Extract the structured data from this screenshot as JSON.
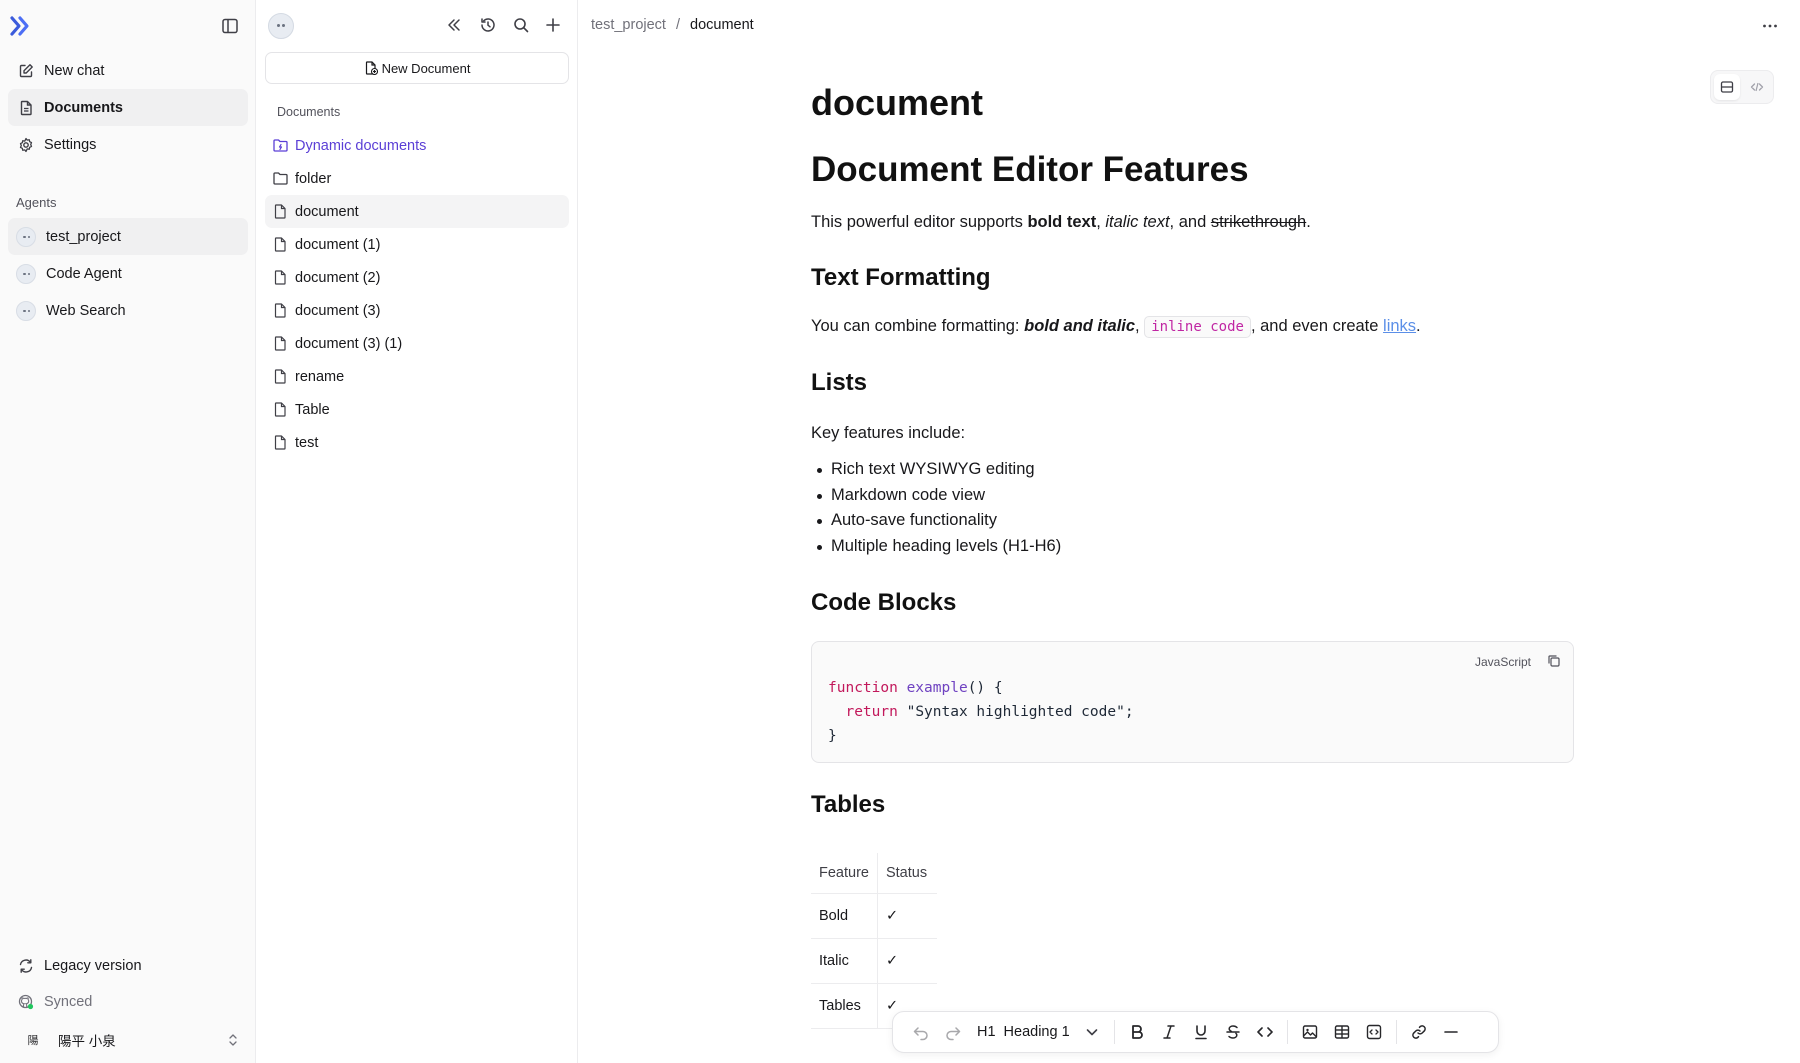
{
  "sidebar": {
    "nav": [
      {
        "label": "New chat",
        "icon": "edit-icon"
      },
      {
        "label": "Documents",
        "icon": "file-icon"
      },
      {
        "label": "Settings",
        "icon": "gear-icon"
      }
    ],
    "agents_label": "Agents",
    "agents": [
      {
        "label": "test_project"
      },
      {
        "label": "Code Agent"
      },
      {
        "label": "Web Search"
      }
    ],
    "legacy_label": "Legacy version",
    "synced_label": "Synced",
    "user": {
      "avatar": "陽",
      "name": "陽平 小泉"
    }
  },
  "doc_panel": {
    "new_document_label": "New Document",
    "section_label": "Documents",
    "items": [
      {
        "label": "Dynamic documents",
        "icon": "dynamic-folder-icon"
      },
      {
        "label": "folder",
        "icon": "folder-icon"
      },
      {
        "label": "document",
        "icon": "file-icon"
      },
      {
        "label": "document (1)",
        "icon": "file-icon"
      },
      {
        "label": "document (2)",
        "icon": "file-icon"
      },
      {
        "label": "document (3)",
        "icon": "file-icon"
      },
      {
        "label": "document (3) (1)",
        "icon": "file-icon"
      },
      {
        "label": "rename",
        "icon": "file-icon"
      },
      {
        "label": "Table",
        "icon": "file-icon"
      },
      {
        "label": "test",
        "icon": "file-icon"
      }
    ]
  },
  "breadcrumb": {
    "project": "test_project",
    "separator": "/",
    "current": "document"
  },
  "document": {
    "title": "document",
    "h1": "Document Editor Features",
    "intro": {
      "pre": "This powerful editor supports ",
      "bold": "bold text",
      "sep1": ", ",
      "italic": "italic text",
      "sep2": ", and ",
      "strike": "strikethrough",
      "end": "."
    },
    "h2_formatting": "Text Formatting",
    "formatting": {
      "pre": "You can combine formatting: ",
      "bold_italic": "bold and italic",
      "sep1": ", ",
      "code": "inline code",
      "sep2": ", and even create ",
      "link": "links",
      "end": "."
    },
    "h2_lists": "Lists",
    "lists_intro": "Key features include:",
    "list_items": [
      "Rich text WYSIWYG editing",
      "Markdown code view",
      "Auto-save functionality",
      "Multiple heading levels (H1-H6)"
    ],
    "h2_code": "Code Blocks",
    "code": {
      "language": "JavaScript",
      "kw1": "function",
      "fname": "example",
      "l1_rest": "() {",
      "kw2": "return",
      "l2_rest": " \"Syntax highlighted code\";",
      "l3": "}"
    },
    "h2_tables": "Tables",
    "table": {
      "headers": [
        "Feature",
        "Status"
      ],
      "rows": [
        [
          "Bold",
          "✓"
        ],
        [
          "Italic",
          "✓"
        ],
        [
          "Tables",
          "✓"
        ]
      ]
    }
  },
  "toolbar": {
    "heading_key": "H1",
    "heading_label": "Heading 1"
  }
}
